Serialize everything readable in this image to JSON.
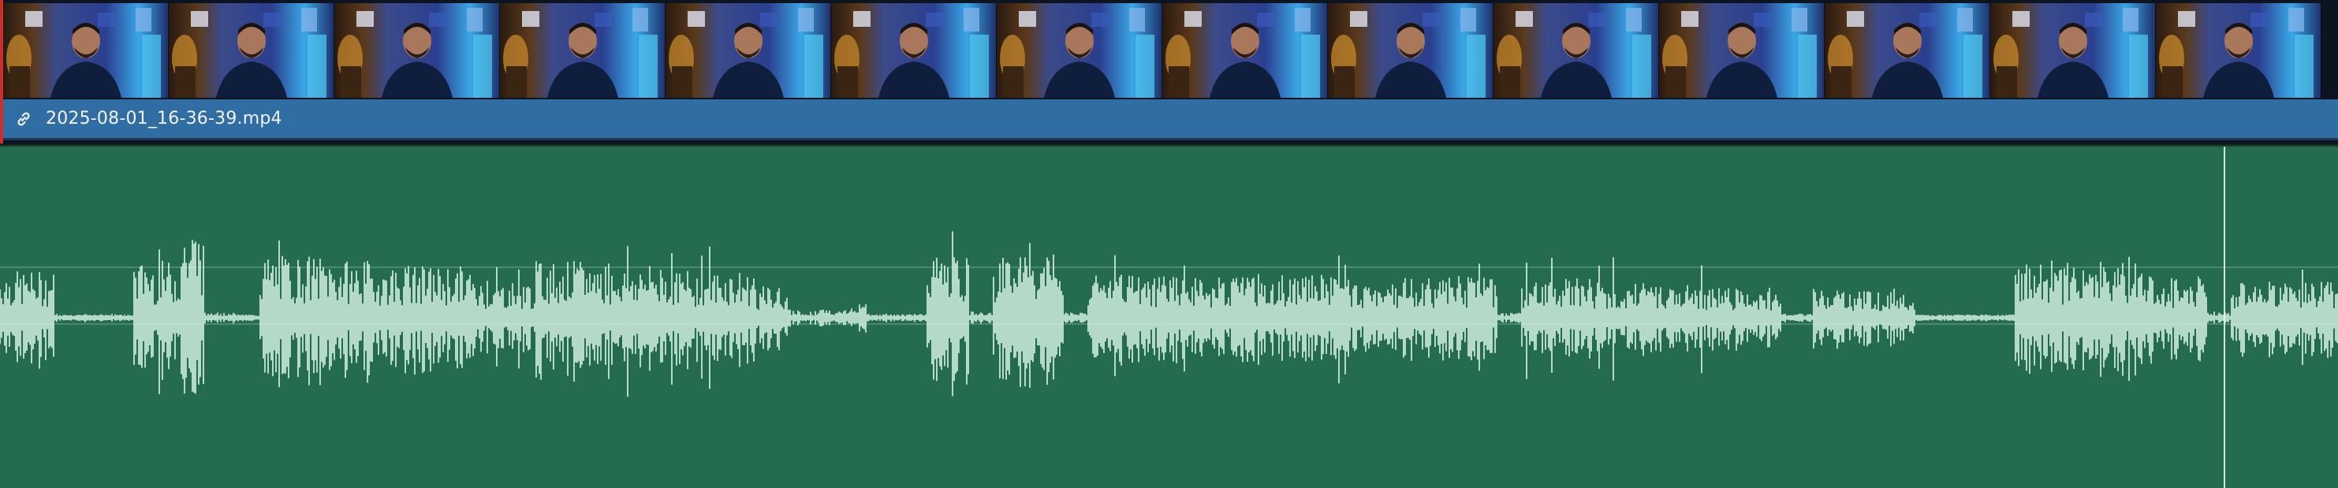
{
  "video_clip": {
    "filename": "2025-08-01_16-36-39.mp4",
    "link_icon": "link-icon",
    "accent_color": "#c9302c",
    "bar_color": "#2f6da3",
    "thumbnail_count": 14
  },
  "audio_clip": {
    "waveform_color": "#d9f5e6",
    "background_color": "#246b4f"
  },
  "playhead": {
    "color": "#e8f2ec"
  }
}
